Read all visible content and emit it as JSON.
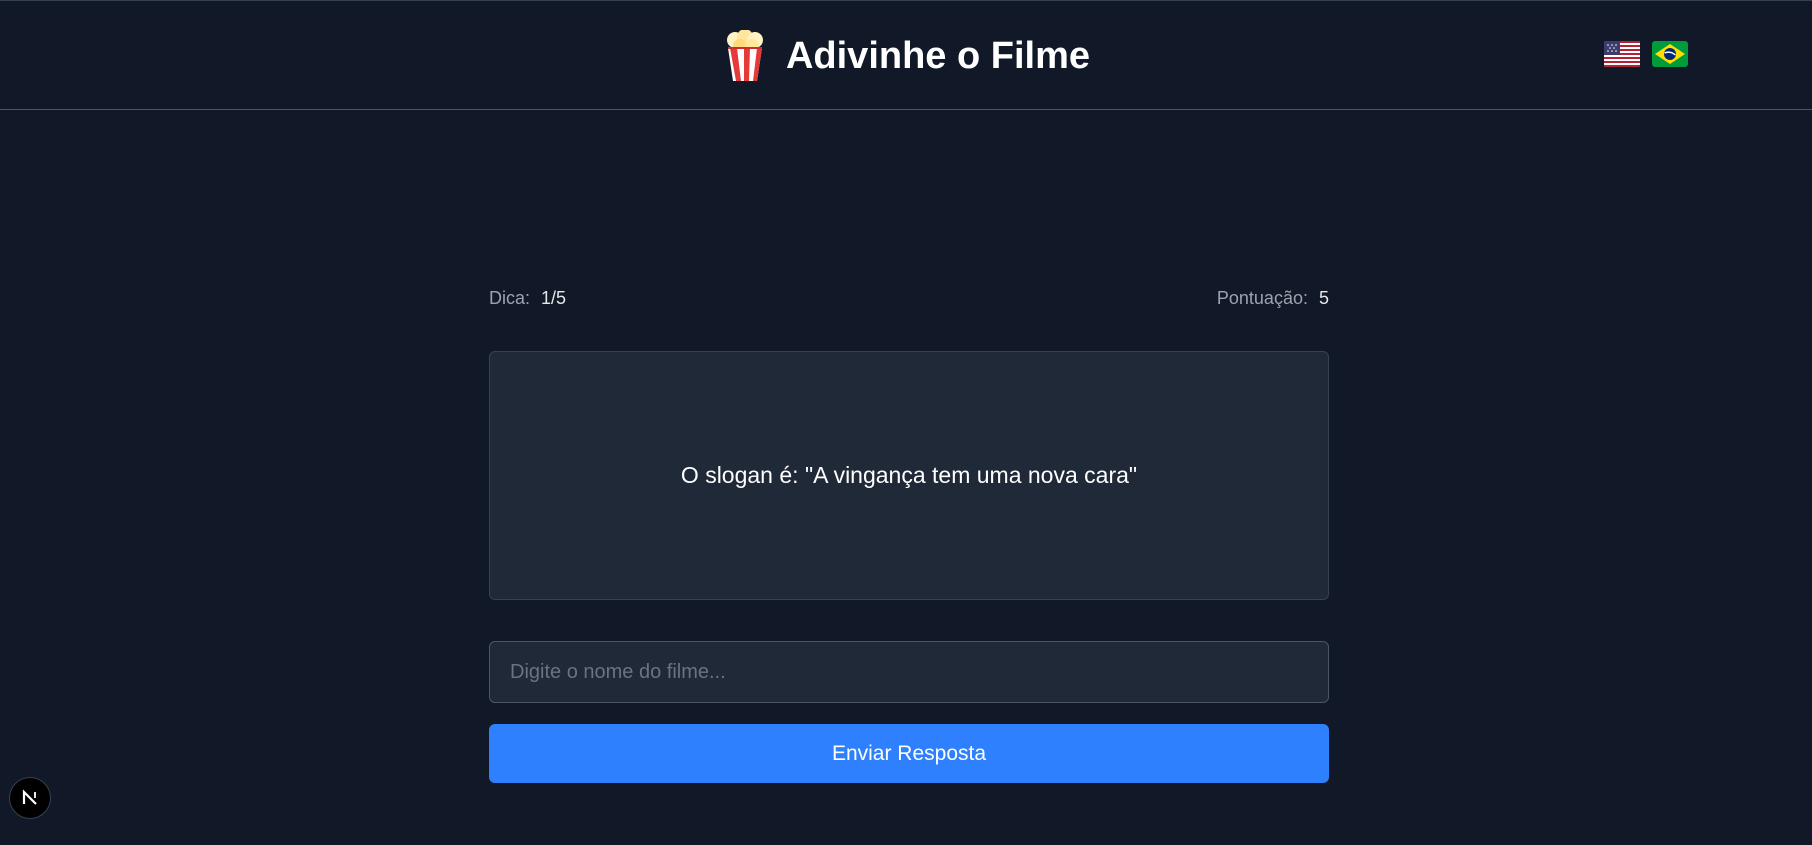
{
  "header": {
    "title": "Adivinhe o Filme",
    "logo_icon": "popcorn-icon",
    "languages": [
      {
        "name": "English",
        "icon": "us-flag-icon"
      },
      {
        "name": "Português",
        "icon": "brazil-flag-icon"
      }
    ]
  },
  "game": {
    "hint_label": "Dica:",
    "hint_value": "1/5",
    "score_label": "Pontuação:",
    "score_value": "5",
    "hint_text": "O slogan é: \"A vingança tem uma nova cara\""
  },
  "guess": {
    "placeholder": "Digite o nome do filme...",
    "value": "",
    "submit_label": "Enviar Resposta"
  },
  "dev_badge": {
    "icon": "nextjs-icon"
  },
  "colors": {
    "background": "#111827",
    "card": "#1f2937",
    "accent": "#2f80ff",
    "muted_text": "#9ca3af"
  }
}
